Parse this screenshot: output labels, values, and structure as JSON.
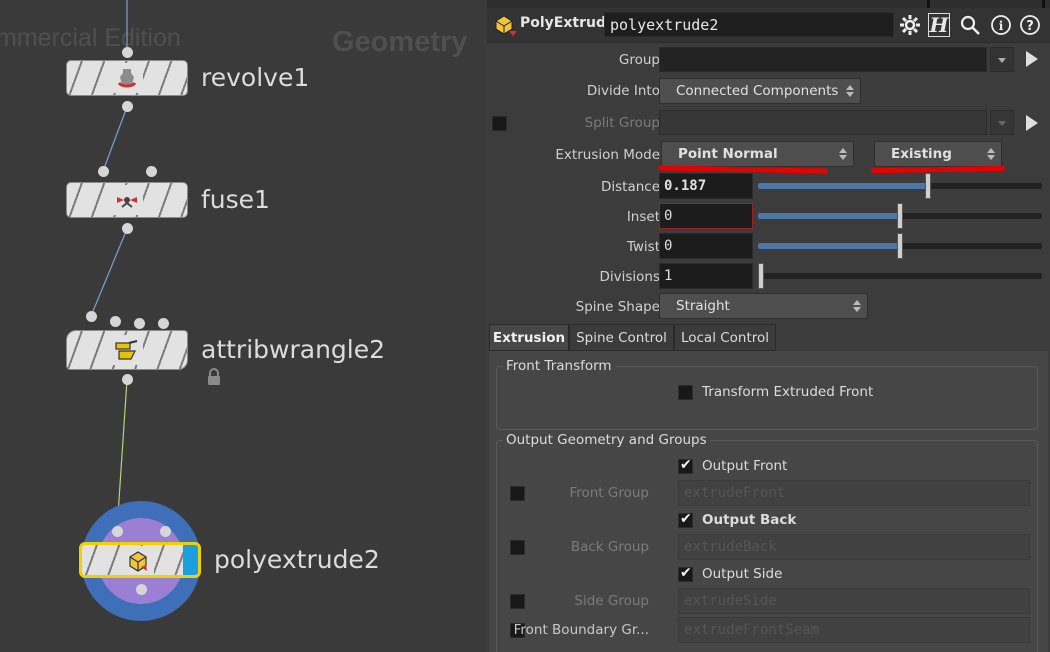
{
  "network": {
    "watermark_edition": "mmercial Edition",
    "watermark_context": "Geometry",
    "nodes": [
      {
        "name": "revolve1",
        "icon": "revolve-icon"
      },
      {
        "name": "fuse1",
        "icon": "fuse-icon"
      },
      {
        "name": "attribwrangle2",
        "icon": "wrangle-icon",
        "locked": true
      },
      {
        "name": "polyextrude2",
        "icon": "polyextrude-icon",
        "selected": true
      }
    ]
  },
  "params": {
    "node_type": "PolyExtrude",
    "node_name": "polyextrude2",
    "toolbar_icons": [
      "gear-icon",
      "houdini-help-icon",
      "search-icon",
      "info-icon",
      "help-icon"
    ],
    "labels": {
      "group": "Group",
      "divide_into": "Divide Into",
      "split_group": "Split Group",
      "extrusion_mode": "Extrusion Mode",
      "distance": "Distance",
      "inset": "Inset",
      "twist": "Twist",
      "divisions": "Divisions",
      "spine_shape": "Spine Shape"
    },
    "values": {
      "group": "",
      "divide_into": "Connected Components",
      "split_group": "",
      "extrusion_mode": "Point Normal",
      "extrusion_mode_secondary": "Existing",
      "distance": "0.187",
      "inset": "0",
      "twist": "0",
      "divisions": "1",
      "spine_shape": "Straight"
    },
    "sliders": {
      "distance": 0.6,
      "inset": 0.5,
      "twist": 0.5,
      "divisions": 0.0
    },
    "tabs": [
      {
        "label": "Extrusion",
        "active": true
      },
      {
        "label": "Spine Control",
        "active": false
      },
      {
        "label": "Local Control",
        "active": false
      }
    ],
    "front_transform": {
      "title": "Front Transform",
      "transform_extruded_front": "Transform Extruded Front",
      "transform_checked": false
    },
    "output": {
      "title": "Output Geometry and Groups",
      "output_front": "Output Front",
      "front_group_label": "Front Group",
      "front_group_value": "extrudeFront",
      "output_back": "Output Back",
      "back_group_label": "Back Group",
      "back_group_value": "extrudeBack",
      "output_side": "Output Side",
      "side_group_label": "Side Group",
      "side_group_value": "extrudeSide",
      "front_boundary_label": "Front Boundary Gr...",
      "front_boundary_value": "extrudeFrontSeam",
      "output_front_checked": true,
      "output_back_checked": true,
      "output_side_checked": true
    },
    "annotation_color": "#e60000",
    "selection_color": "#f0d000"
  }
}
